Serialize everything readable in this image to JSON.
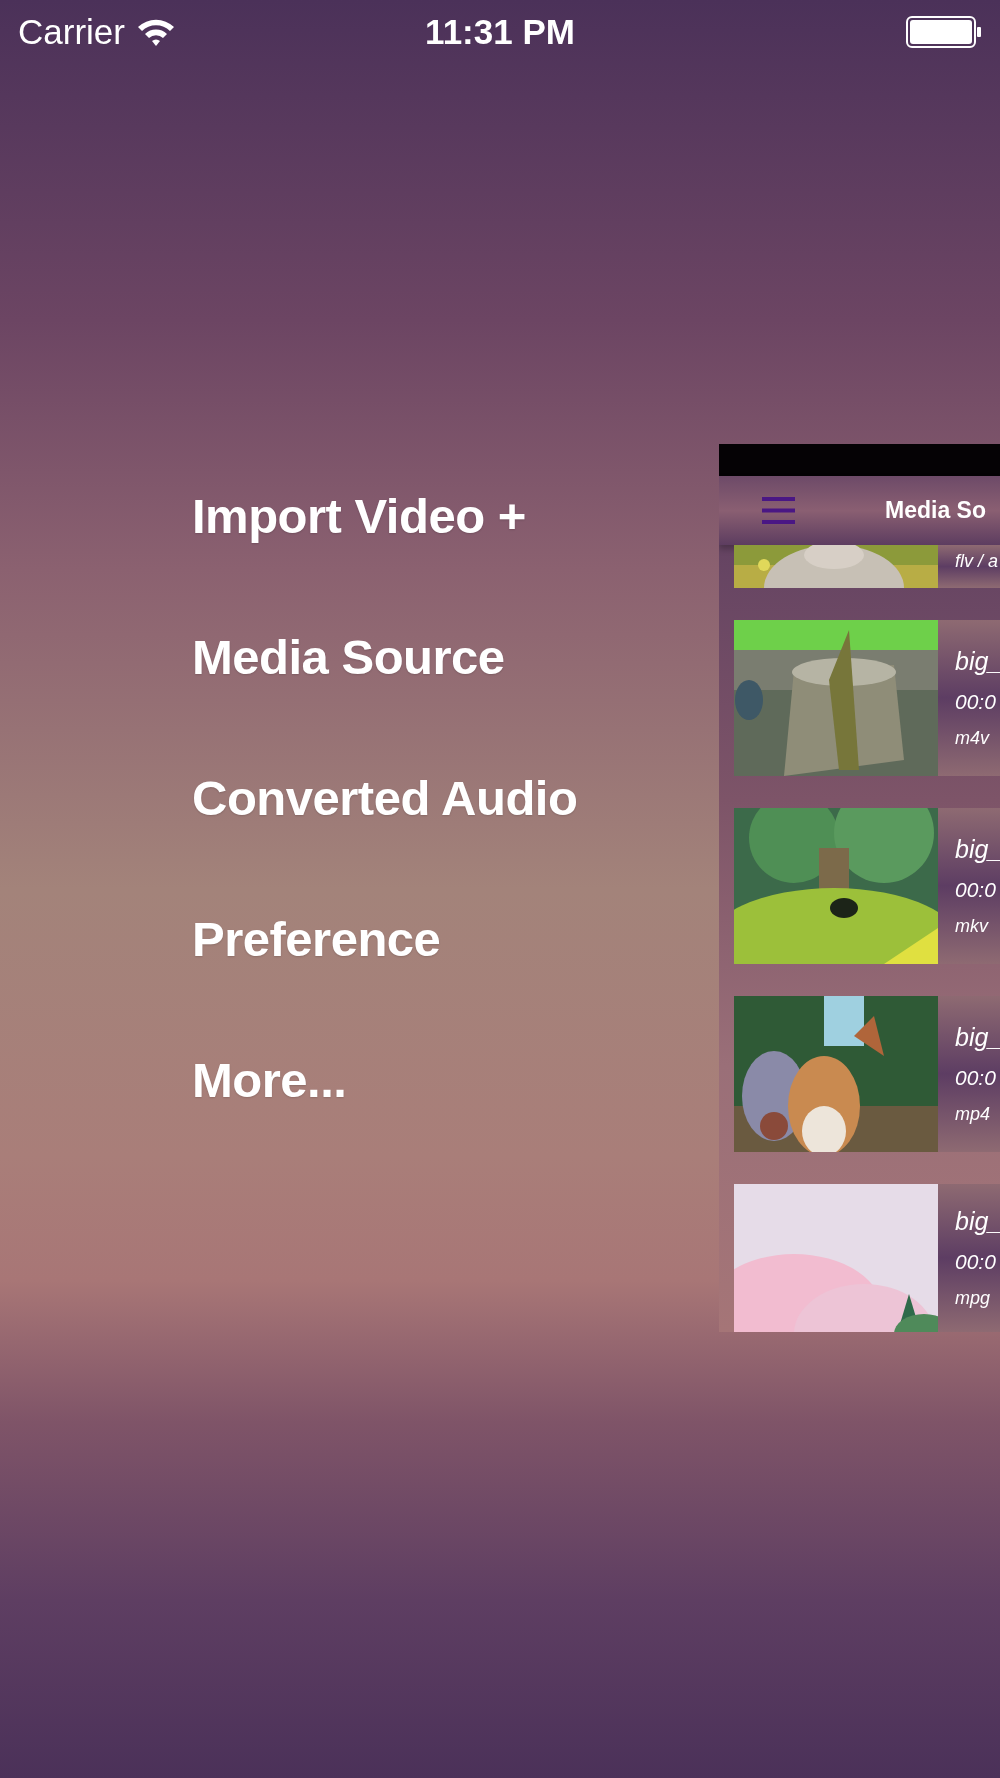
{
  "status_bar": {
    "carrier": "Carrier",
    "time": "11:31 PM"
  },
  "menu": {
    "items": [
      {
        "label": "Import Video +"
      },
      {
        "label": "Media Source"
      },
      {
        "label": "Converted Audio"
      },
      {
        "label": "Preference"
      },
      {
        "label": "More..."
      }
    ]
  },
  "panel": {
    "title": "Media So",
    "partial_row": {
      "format": "flv / a"
    },
    "rows": [
      {
        "title": "big_",
        "duration": "00:0",
        "format": "m4v"
      },
      {
        "title": "big_",
        "duration": "00:0",
        "format": "mkv"
      },
      {
        "title": "big_",
        "duration": "00:0",
        "format": "mp4"
      },
      {
        "title": "big_",
        "duration": "00:0",
        "format": "mpg"
      }
    ]
  }
}
